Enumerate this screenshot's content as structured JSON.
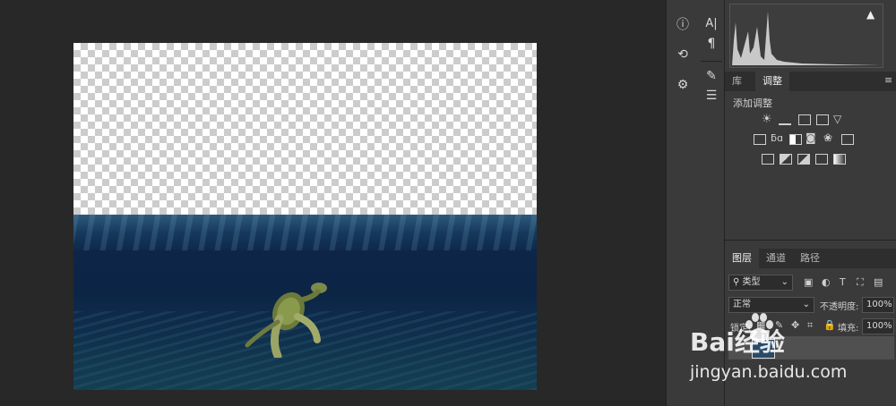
{
  "adjustments_panel": {
    "tabs": [
      "库",
      "调整"
    ],
    "heading": "添加调整"
  },
  "layers_panel": {
    "tabs": [
      "图层",
      "通道",
      "路径"
    ],
    "filter_kind": "类型",
    "blend_mode": "正常",
    "opacity_label": "不透明度:",
    "opacity_value": "100%",
    "lock_label": "锁定:",
    "fill_label": "填充:",
    "fill_value": "100%"
  },
  "toolbar2": {
    "type_label": "A|",
    "paragraph_label": "¶"
  },
  "watermark": {
    "brand": "Bai经验",
    "url": "jingyan.baidu.com"
  }
}
